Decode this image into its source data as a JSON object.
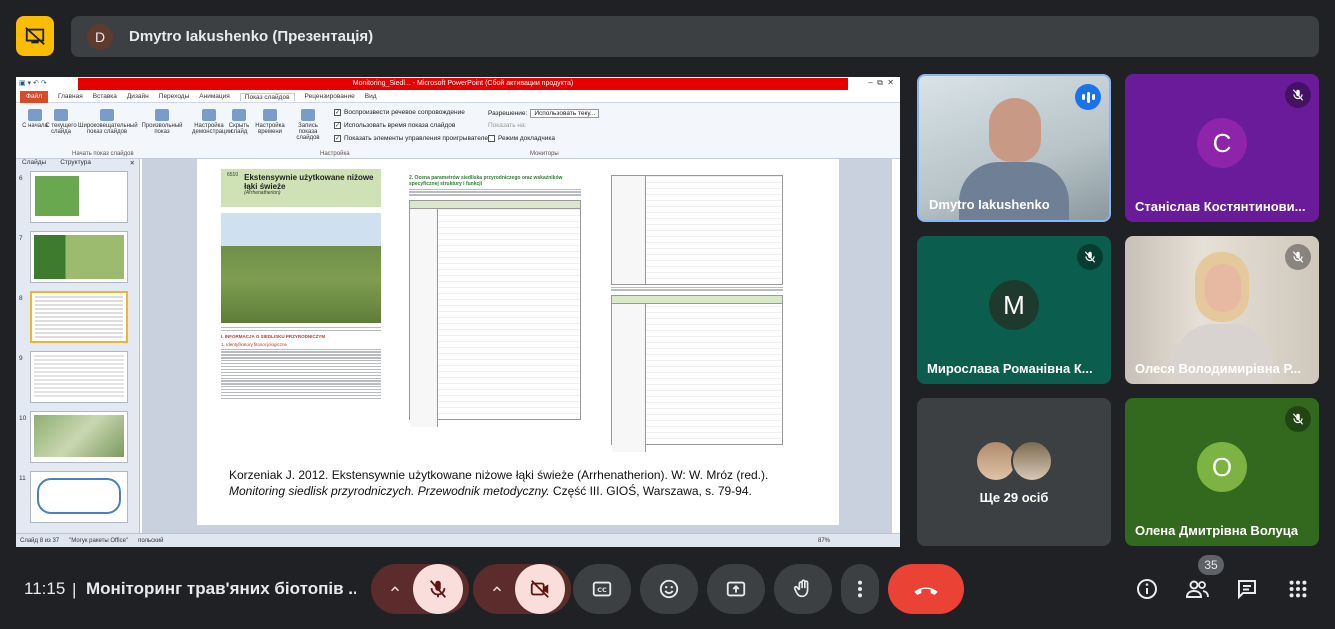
{
  "presentation": {
    "presenter_initial": "D",
    "presenter_label": "Dmytro Iakushenko (Презентація)"
  },
  "ppt": {
    "window_title": "Monitoring_Siedl... - Microsoft PowerPoint (Сбой активации продукта)",
    "tabs": [
      "Файл",
      "Главная",
      "Вставка",
      "Дизайн",
      "Переходы",
      "Анимация",
      "Показ слайдов",
      "Рецензирование",
      "Вид"
    ],
    "ribbon_buttons": [
      "С начала",
      "С текущего слайда",
      "Широковещательный показ слайдов",
      "Произвольный показ",
      "Настройка демонстрации",
      "Скрыть слайд",
      "Настройка времени",
      "Запись показа слайдов"
    ],
    "checks": [
      "Воспроизвести речевое сопровождение",
      "Использовать время показа слайдов",
      "Показать элементы управления проигрывателем"
    ],
    "resolution_label": "Разрешение:",
    "resolution_value": "Использовать теку...",
    "show_on": "Показать на:",
    "presenter_mode": "Режим докладчика",
    "group_labels": [
      "Начать показ слайдов",
      "Настройка",
      "Мониторы"
    ],
    "panel_tabs": [
      "Слайды",
      "Структура"
    ],
    "slide_numbers": [
      "6",
      "7",
      "8",
      "9",
      "10",
      "11"
    ],
    "status": [
      "Слайд 8 из 37",
      "\"Могук ракеты Office\"",
      "польский"
    ],
    "zoom": "87%"
  },
  "slide": {
    "heading_code": "6510",
    "heading": "Ekstensywnie użytkowane niżowe łąki świeże",
    "heading_sub": "(Arrhenatherion)",
    "section1": "I. INFORMACJA O SIEDLISKU PRZYRODNICZYM",
    "section1a": "1. Identyfikatory fitosocjologiczne",
    "mid_heading": "2. Ocena parametrów siedliska przyrodniczego oraz wskaźników specyficznej struktury i funkcji",
    "caption_line1": "Korzeniak J. 2012. Ekstensywnie użytkowane niżowe łąki świeże (Arrhenatherion). W: W. Mróz (red.).",
    "caption_italic": "Monitoring siedlisk przyrodniczych. Przewodnik metodyczny.",
    "caption_rest": " Część III. GIOŚ, Warszawa, s. 79-94."
  },
  "participants": [
    {
      "name": "Dmytro Iakushenko",
      "type": "video",
      "speaking": true
    },
    {
      "name": "Станіслав Костянтинови...",
      "initial": "С",
      "color": "#8e24aa",
      "bg": "#6a1b9a",
      "muted": true
    },
    {
      "name": "Мирослава Романівна К...",
      "initial": "М",
      "color": "#1e3a2e",
      "bg": "#0b5d4e",
      "muted": true
    },
    {
      "name": "Олеся Володимирівна Р...",
      "type": "video",
      "muted": true
    },
    {
      "name": "Ще 29 осіб",
      "type": "others"
    },
    {
      "name": "Олена Дмитрівна Волуца",
      "initial": "О",
      "color": "#7cb342",
      "bg": "#33691e",
      "muted": true
    }
  ],
  "bottom": {
    "time": "11:15",
    "separator": "|",
    "meeting_title": "Моніторинг трав'яних біотопів ...",
    "participant_count": "35"
  },
  "colors": {
    "accent": "#fbbc04",
    "end_call": "#ea4335",
    "muted_bg": "#f9dedc"
  }
}
